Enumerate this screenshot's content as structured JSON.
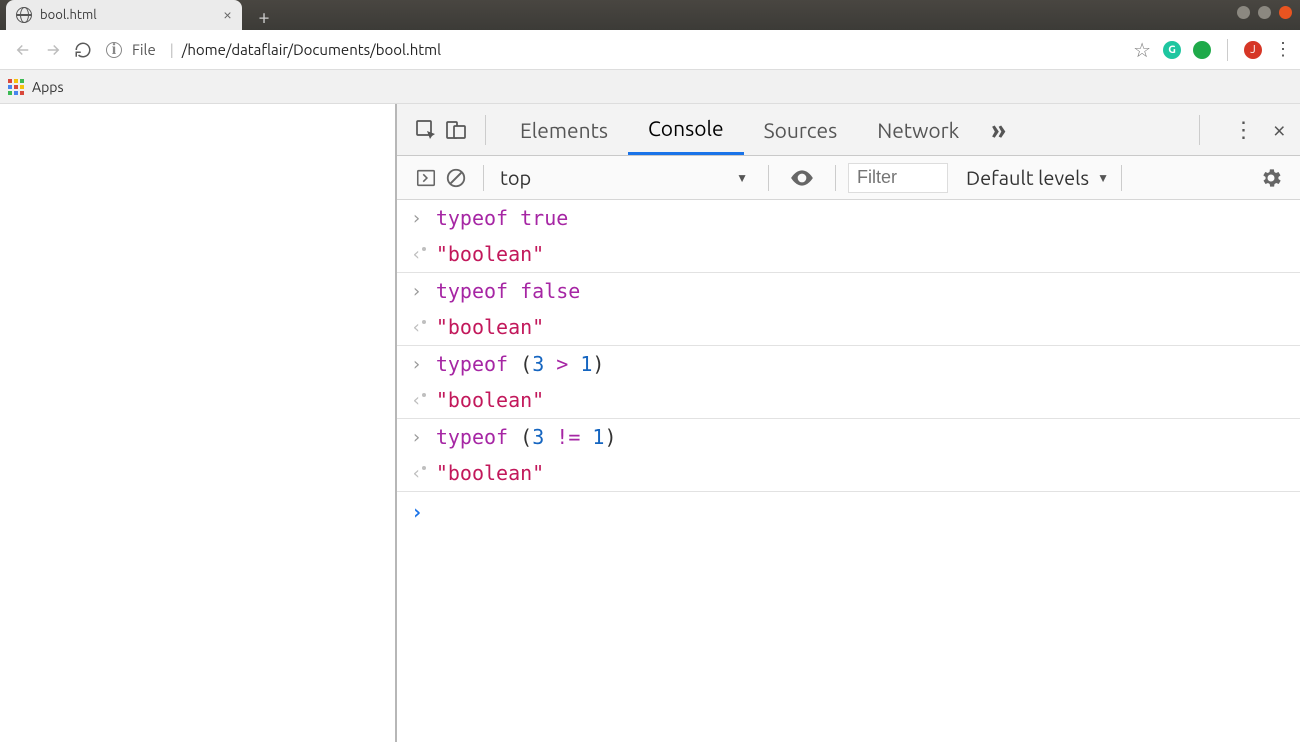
{
  "window": {
    "minimize": "min",
    "maximize": "max",
    "close": "close"
  },
  "tab": {
    "title": "bool.html"
  },
  "addrbar": {
    "scheme": "File",
    "path": "/home/dataflair/Documents/bool.html",
    "avatar_initial": "J",
    "grammarly": "G"
  },
  "bookmarks": {
    "apps": "Apps"
  },
  "devtools": {
    "tabs": [
      "Elements",
      "Console",
      "Sources",
      "Network"
    ],
    "active_tab": "Console",
    "toolbar": {
      "context": "top",
      "filter_placeholder": "Filter",
      "levels": "Default levels"
    },
    "console": [
      {
        "input": [
          {
            "t": "kw",
            "v": "typeof"
          },
          {
            "t": "sp",
            "v": " "
          },
          {
            "t": "kw",
            "v": "true"
          }
        ],
        "output": "\"boolean\""
      },
      {
        "input": [
          {
            "t": "kw",
            "v": "typeof"
          },
          {
            "t": "sp",
            "v": " "
          },
          {
            "t": "kw",
            "v": "false"
          }
        ],
        "output": "\"boolean\""
      },
      {
        "input": [
          {
            "t": "kw",
            "v": "typeof"
          },
          {
            "t": "sp",
            "v": " "
          },
          {
            "t": "paren",
            "v": "("
          },
          {
            "t": "num",
            "v": "3"
          },
          {
            "t": "sp",
            "v": " "
          },
          {
            "t": "op",
            "v": ">"
          },
          {
            "t": "sp",
            "v": " "
          },
          {
            "t": "num",
            "v": "1"
          },
          {
            "t": "paren",
            "v": ")"
          }
        ],
        "output": "\"boolean\""
      },
      {
        "input": [
          {
            "t": "kw",
            "v": "typeof"
          },
          {
            "t": "sp",
            "v": " "
          },
          {
            "t": "paren",
            "v": "("
          },
          {
            "t": "num",
            "v": "3"
          },
          {
            "t": "sp",
            "v": " "
          },
          {
            "t": "op",
            "v": "!="
          },
          {
            "t": "sp",
            "v": " "
          },
          {
            "t": "num",
            "v": "1"
          },
          {
            "t": "paren",
            "v": ")"
          }
        ],
        "output": "\"boolean\""
      }
    ]
  }
}
